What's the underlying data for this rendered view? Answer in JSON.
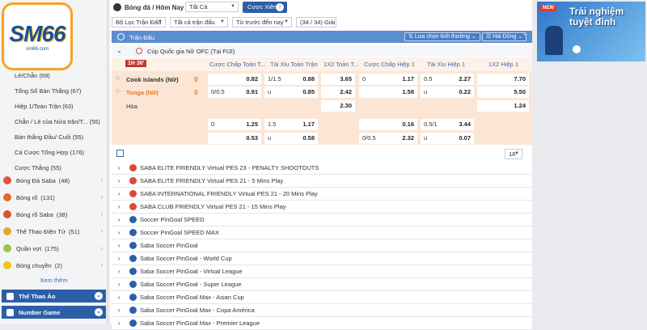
{
  "logo": {
    "text": "SM66",
    "sub": "sm66.com"
  },
  "sidebar": {
    "sub_items": [
      {
        "label": "Lẻ/Chẵn (69)"
      },
      {
        "label": "Tổng Số Bàn Thắng (67)"
      },
      {
        "label": "Hiệp 1/Toàn Trận (63)"
      },
      {
        "label": "Chẵn / Lẻ của Nửa trận/T...  (55)"
      },
      {
        "label": "Bàn thắng Đầu/ Cuối (55)"
      },
      {
        "label": "Cá Cược Tổng Hợp (176)"
      },
      {
        "label": "Cược Thắng (55)"
      }
    ],
    "sports": [
      {
        "label": "Bóng Đá Saba",
        "count": "(48)",
        "color": "#e0543a"
      },
      {
        "label": "Bóng rổ",
        "count": "(131)",
        "color": "#e36b2a"
      },
      {
        "label": "Bóng rổ Saba",
        "count": "(38)",
        "color": "#d9572b"
      },
      {
        "label": "Thể Thao Điện Tử",
        "count": "(51)",
        "color": "#e8a42c"
      },
      {
        "label": "Quần vợt",
        "count": "(175)",
        "color": "#9bc53d"
      },
      {
        "label": "Bóng chuyền",
        "count": "(2)",
        "color": "#f0c419"
      }
    ],
    "more": "Xem thêm",
    "sections": [
      {
        "label": "Thể Thao Ảo"
      },
      {
        "label": "Number Game"
      }
    ]
  },
  "topbar": {
    "breadcrumb": "Bóng đá / Hôm Nay",
    "filter_all": "Tất Cả",
    "parlay_button": "Cược Xiên",
    "filter_league": "Bộ Lọc Trận Đấu",
    "filter_type": "Tất cả trận đấu",
    "sort": "Từ trước đến nay",
    "count": "(34 / 34) Giải"
  },
  "header": {
    "title": "Trận Đấu",
    "select_label": "Lựa chọn tính thường",
    "odds_label": "Hai Dòng"
  },
  "league": {
    "name": "Cúp Quốc gia Nữ OFC (Tại FIJI)"
  },
  "columns": {
    "time": "1H 36'",
    "headers": [
      "Cược Chấp Toàn T...",
      "Tài Xỉu Toàn Trận",
      "1X2 Toàn T...",
      "Cược Chấp Hiệp 1",
      "Tài Xỉu Hiệp 1",
      "1X2 Hiệp 1"
    ]
  },
  "match": {
    "home": "Cook Islands (Nữ)",
    "away": "Tonga (Nữ)",
    "draw": "Hòa",
    "home_score": "0",
    "away_score": "0",
    "lines": {
      "r1": [
        {
          "l": "",
          "r": "0.82"
        },
        {
          "l": "1/1.5",
          "r": "0.88"
        },
        {
          "l": "",
          "r": "3.65"
        },
        {
          "l": "0",
          "r": "1.17"
        },
        {
          "l": "0.5",
          "r": "2.27"
        },
        {
          "l": "",
          "r": "7.70"
        }
      ],
      "r2": [
        {
          "l": "0/0.5",
          "r": "0.91"
        },
        {
          "l": "u",
          "r": "0.85"
        },
        {
          "l": "",
          "r": "2.42"
        },
        {
          "l": "",
          "r": "1.58"
        },
        {
          "l": "u",
          "r": "0.22"
        },
        {
          "l": "",
          "r": "5.50"
        }
      ],
      "r3": [
        {
          "l": "",
          "r": "2.30"
        },
        {
          "l": "",
          "r": "1.24"
        }
      ],
      "r4": [
        {
          "l": "0",
          "r": "1.25"
        },
        {
          "l": "1.5",
          "r": "1.17"
        },
        {
          "l": "",
          "r": "0.16"
        },
        {
          "l": "0.5/1",
          "r": "3.44"
        }
      ],
      "r5": [
        {
          "l": "",
          "r": "0.53"
        },
        {
          "l": "u",
          "r": "0.58"
        },
        {
          "l": "0/0.5",
          "r": "2.32"
        },
        {
          "l": "u",
          "r": "0.07"
        }
      ]
    }
  },
  "pager": {
    "value": "18"
  },
  "leagues": [
    {
      "name": "SABA ELITE FRIENDLY Virtual PES 23 - PENALTY SHOOTOUTS"
    },
    {
      "name": "SABA ELITE FRIENDLY Virtual PES 21 - 5 Mins Play"
    },
    {
      "name": "SABA INTERNATIONAL FRIENDLY Virtual PES 21 - 20 Mins Play"
    },
    {
      "name": "SABA CLUB FRIENDLY Virtual PES 21 - 15 Mins Play"
    },
    {
      "name": "Soccer PinGoal SPEED"
    },
    {
      "name": "Soccer PinGoal SPEED MAX"
    },
    {
      "name": "Saba Soccer PinGoal"
    },
    {
      "name": "Saba Soccer PinGoal - World Cup"
    },
    {
      "name": "Saba Soccer PinGoal - Virtual League"
    },
    {
      "name": "Saba Soccer PinGoal - Super League"
    },
    {
      "name": "Saba Soccer PinGoal Max - Asian Cup"
    },
    {
      "name": "Saba Soccer PinGoal Max - Copa América"
    },
    {
      "name": "Saba Soccer PinGoal Max - Premier League"
    }
  ],
  "banner": {
    "line1": "Trải nghiệm",
    "line2": "tuyệt đỉnh",
    "badge": "NEW"
  }
}
